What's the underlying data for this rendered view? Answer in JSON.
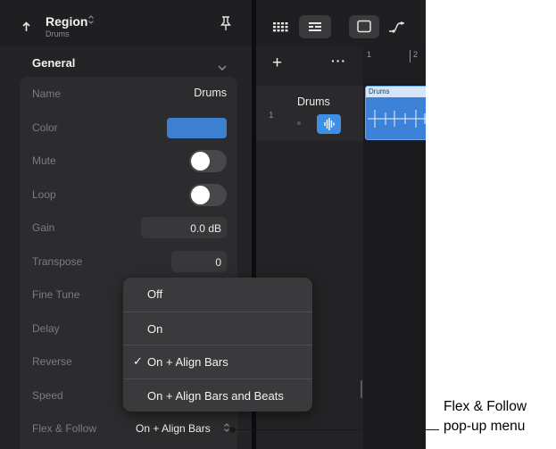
{
  "inspector": {
    "header": {
      "title": "Region",
      "subtitle": "Drums",
      "back_icon": "back-arrow-icon",
      "pin_icon": "pin-icon"
    },
    "section": {
      "title": "General",
      "icon": "chevron-down-icon"
    },
    "params": {
      "name": {
        "label": "Name",
        "value": "Drums"
      },
      "color": {
        "label": "Color",
        "value": "#3d7fd0"
      },
      "mute": {
        "label": "Mute",
        "on": false
      },
      "loop": {
        "label": "Loop",
        "on": false
      },
      "gain": {
        "label": "Gain",
        "value": "0.0 dB"
      },
      "transpose": {
        "label": "Transpose",
        "value": "0"
      },
      "fine_tune": {
        "label": "Fine Tune"
      },
      "delay": {
        "label": "Delay"
      },
      "reverse": {
        "label": "Reverse"
      },
      "speed": {
        "label": "Speed"
      },
      "flex_follow": {
        "label": "Flex & Follow",
        "value": "On + Align Bars"
      }
    }
  },
  "toolbar": {
    "buttons": [
      "grid-view-icon",
      "list-view-icon",
      "window-icon",
      "automation-curve-icon"
    ]
  },
  "tracks": {
    "add_label": "+",
    "more_label": "···",
    "items": [
      {
        "number": "1",
        "name": "Drums",
        "icon": "drum-waveform-icon"
      }
    ]
  },
  "timeline": {
    "bars": [
      "1",
      "2"
    ],
    "region": {
      "name": "Drums"
    }
  },
  "popup_menu": {
    "items": [
      {
        "label": "Off",
        "checked": false
      },
      {
        "label": "On",
        "checked": false
      },
      {
        "label": "On + Align Bars",
        "checked": true
      },
      {
        "label": "On + Align Bars and Beats",
        "checked": false
      }
    ],
    "check_mark": "✓"
  },
  "callout": {
    "line1": "Flex & Follow",
    "line2": "pop-up menu"
  },
  "colors": {
    "accent": "#3d8fe6",
    "region": "#3b82d8",
    "panel": "#2c2c2e",
    "background": "#1c1c1e"
  }
}
